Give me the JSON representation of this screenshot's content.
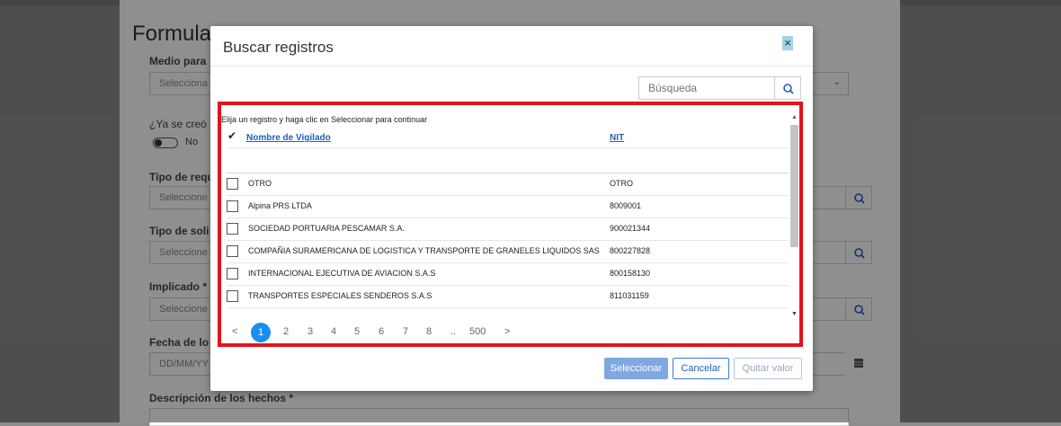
{
  "background_form": {
    "title": "Formula",
    "labels": {
      "medio": "Medio para",
      "ya_se_creo": "¿Ya se creó",
      "tipo_req": "Tipo de requ",
      "tipo_sol": "Tipo de soli",
      "implicado": "Implicado *",
      "fecha": "Fecha de lo",
      "descripcion": "Descripción de los hechos *"
    },
    "values": {
      "medio": "Selecciona",
      "tipo_req": "Seleccione",
      "tipo_sol": "Seleccione",
      "implicado": "Seleccione",
      "fecha": "DD/MM/YY"
    },
    "toggle_label": "No"
  },
  "modal": {
    "title": "Buscar registros",
    "close_label": "×",
    "search": {
      "placeholder": "Búsqueda"
    },
    "instruction": "Elija un registro y haga clic en Seleccionar para continuar",
    "columns": {
      "check": "✔",
      "name": "Nombre de Vigilado",
      "nit": "NIT"
    },
    "rows": [
      {
        "name": "OTRO",
        "nit": "OTRO"
      },
      {
        "name": "Alpina PRS LTDA",
        "nit": "8009001"
      },
      {
        "name": "SOCIEDAD PORTUARIA PESCAMAR S.A.",
        "nit": "900021344"
      },
      {
        "name": "COMPAÑIA SURAMERICANA DE LOGISTICA Y TRANSPORTE DE GRANELES LIQUIDOS SAS",
        "nit": "800227828"
      },
      {
        "name": "INTERNACIONAL EJECUTIVA DE AVIACION S.A.S",
        "nit": "800158130"
      },
      {
        "name": "TRANSPORTES ESPECIALES SENDEROS S.A.S",
        "nit": "811031159"
      }
    ],
    "pagination": {
      "prev": "<",
      "pages": [
        "1",
        "2",
        "3",
        "4",
        "5",
        "6",
        "7",
        "8"
      ],
      "ellipsis": "..",
      "last": "500",
      "next": ">",
      "current": "1"
    },
    "buttons": {
      "select": "Seleccionar",
      "cancel": "Cancelar",
      "clear": "Quitar valor"
    }
  },
  "colors": {
    "highlight_frame": "#e2131c",
    "accent": "#1a8ef0",
    "link": "#1f5fbf"
  },
  "icons": {
    "search": "search-icon",
    "calendar": "calendar-icon",
    "check": "check-icon"
  }
}
